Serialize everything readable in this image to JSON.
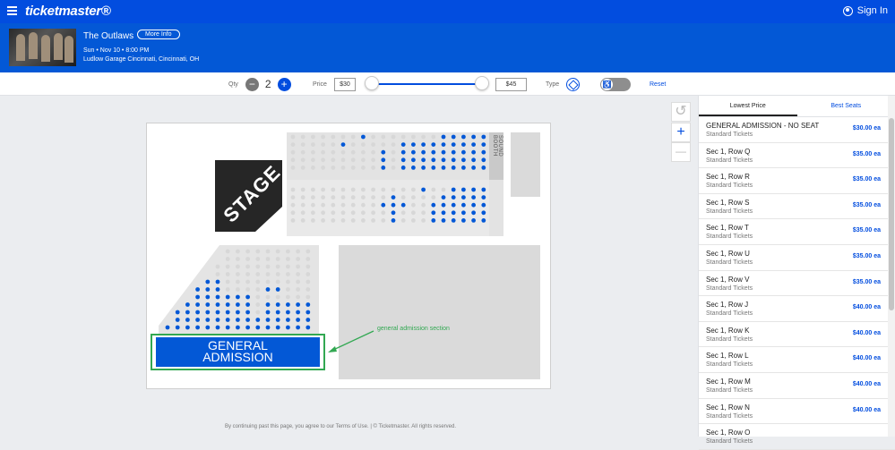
{
  "header": {
    "logo": "ticketmaster®",
    "signin": "Sign In"
  },
  "event": {
    "title": "The Outlaws",
    "more_info": "More Info",
    "date": "Sun • Nov 10 • 8:00 PM",
    "venue": "Ludlow Garage Cincinnati, Cincinnati, OH"
  },
  "filters": {
    "qty_label": "Qty",
    "qty_minus": "−",
    "qty_value": "2",
    "qty_plus": "+",
    "price_label": "Price",
    "price_min": "$30",
    "price_max": "$45",
    "type_label": "Type",
    "accessibility_icon": "♿",
    "reset": "Reset"
  },
  "map": {
    "stage": "STAGE",
    "sound_booth": "SOUND BOOTH",
    "ga_label_1": "GENERAL",
    "ga_label_2": "ADMISSION",
    "annotation": "general admission section",
    "zoom_in": "+",
    "zoom_out": "—",
    "reset_icon": "↺"
  },
  "colors": {
    "brand": "#024ddf",
    "available": "#0358d6",
    "annotation": "#32a852"
  },
  "panel": {
    "tabs": [
      "Lowest Price",
      "Best Seats"
    ],
    "listings": [
      {
        "section": "GENERAL ADMISSION - NO SEAT",
        "type": "Standard Tickets",
        "price": "$30.00 ea"
      },
      {
        "section": "Sec 1, Row Q",
        "type": "Standard Tickets",
        "price": "$35.00 ea"
      },
      {
        "section": "Sec 1, Row R",
        "type": "Standard Tickets",
        "price": "$35.00 ea"
      },
      {
        "section": "Sec 1, Row S",
        "type": "Standard Tickets",
        "price": "$35.00 ea"
      },
      {
        "section": "Sec 1, Row T",
        "type": "Standard Tickets",
        "price": "$35.00 ea"
      },
      {
        "section": "Sec 1, Row U",
        "type": "Standard Tickets",
        "price": "$35.00 ea"
      },
      {
        "section": "Sec 1, Row V",
        "type": "Standard Tickets",
        "price": "$35.00 ea"
      },
      {
        "section": "Sec 1, Row J",
        "type": "Standard Tickets",
        "price": "$40.00 ea"
      },
      {
        "section": "Sec 1, Row K",
        "type": "Standard Tickets",
        "price": "$40.00 ea"
      },
      {
        "section": "Sec 1, Row L",
        "type": "Standard Tickets",
        "price": "$40.00 ea"
      },
      {
        "section": "Sec 1, Row M",
        "type": "Standard Tickets",
        "price": "$40.00 ea"
      },
      {
        "section": "Sec 1, Row N",
        "type": "Standard Tickets",
        "price": "$40.00 ea"
      },
      {
        "section": "Sec 1, Row O",
        "type": "Standard Tickets",
        "price": ""
      }
    ]
  },
  "footer": "By continuing past this page, you agree to our Terms of Use. | © Ticketmaster. All rights reserved."
}
